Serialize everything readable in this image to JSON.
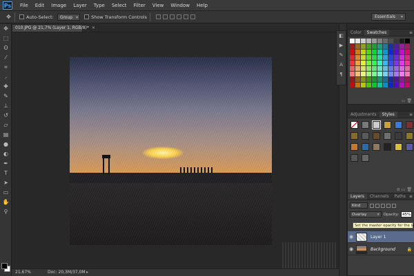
{
  "menubar": {
    "logo": "Ps",
    "items": [
      "File",
      "Edit",
      "Image",
      "Layer",
      "Type",
      "Select",
      "Filter",
      "View",
      "Window",
      "Help"
    ]
  },
  "options": {
    "auto_select_label": "Auto-Select:",
    "auto_select_value": "Group",
    "transform_label": "Show Transform Controls",
    "workspace": "Essentials"
  },
  "document": {
    "tab_title": "010.JPG @ 21,7% (Layer 1, RGB/8)",
    "tab_modified": "*",
    "close_glyph": "×"
  },
  "status": {
    "zoom": "21,67%",
    "doc_size": "Doc: 20,3M/37,0M",
    "arrow": "▸"
  },
  "panels": {
    "color_tab": "Color",
    "swatches_tab": "Swatches",
    "adjustments_tab": "Adjustments",
    "styles_tab": "Styles",
    "layers_tab": "Layers",
    "channels_tab": "Channels",
    "paths_tab": "Paths",
    "menu_glyph": "≡"
  },
  "layers": {
    "kind_label": "Kind",
    "blend_mode": "Overlay",
    "opacity_label": "Opacity:",
    "opacity_value": "45%",
    "tooltip": "Set the master opacity for the layer",
    "items": [
      {
        "name": "Layer 1",
        "selected": true
      },
      {
        "name": "Background",
        "selected": false
      }
    ]
  },
  "colors": {
    "accent": "#596c8e",
    "panel_bg": "#3d3d3d",
    "app_bg": "#282828"
  }
}
